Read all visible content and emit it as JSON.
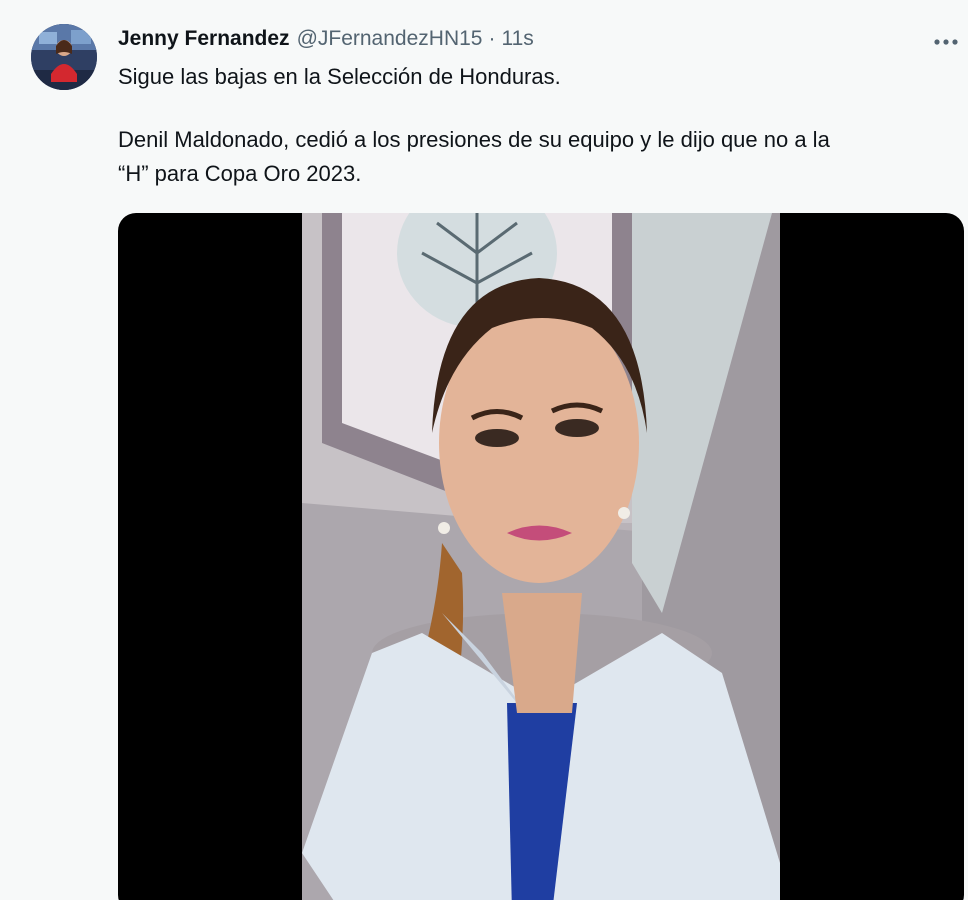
{
  "tweet": {
    "author": {
      "display_name": "Jenny Fernandez",
      "handle": "@JFernandezHN15",
      "separator": "·",
      "timestamp": "11s"
    },
    "more_icon": "more-horizontal-icon",
    "text_line1": "Sigue las bajas en la Selección de Honduras.",
    "text_line2": "Denil Maldonado, cedió a los presiones de su equipo y le dijo que no a la",
    "text_line3": "“H” para Copa Oro 2023."
  },
  "colors": {
    "background": "#f7f9f9",
    "text_primary": "#0f1419",
    "text_secondary": "#536471",
    "media_background": "#000000"
  }
}
